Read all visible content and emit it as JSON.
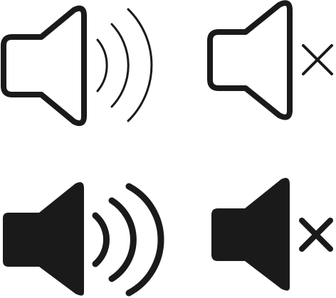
{
  "icons": [
    {
      "name": "speaker-volume-outline-icon",
      "style": "outline",
      "state": "volume-on"
    },
    {
      "name": "speaker-muted-outline-icon",
      "style": "outline",
      "state": "muted"
    },
    {
      "name": "speaker-volume-filled-icon",
      "style": "filled",
      "state": "volume-on"
    },
    {
      "name": "speaker-muted-filled-icon",
      "style": "filled",
      "state": "muted"
    }
  ],
  "colors": {
    "background": "#ffffff",
    "icon": "#1a1a1a"
  }
}
